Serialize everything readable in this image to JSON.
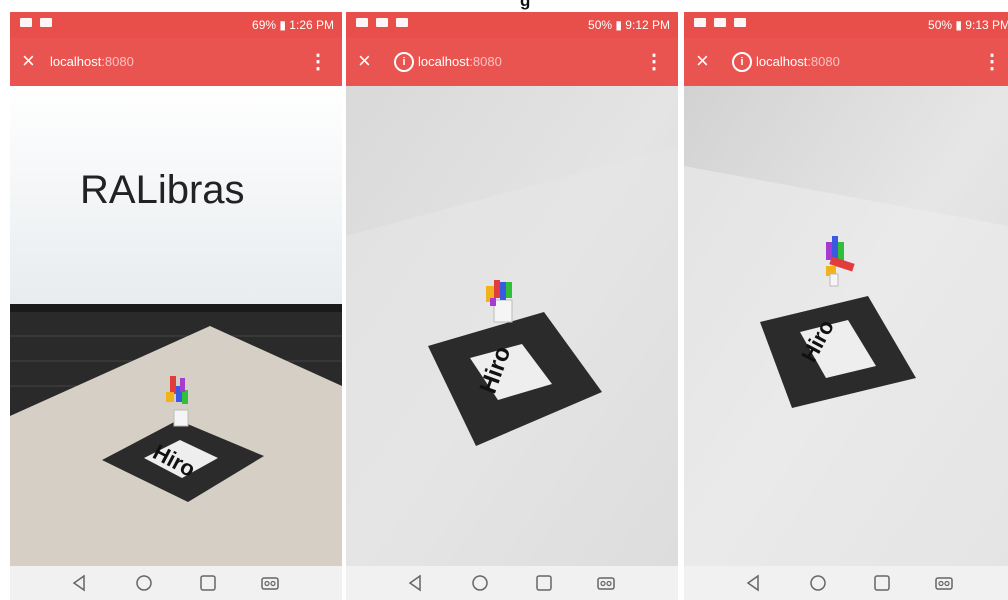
{
  "caption": {
    "visible_text": "g"
  },
  "screens": [
    {
      "status": {
        "right": "69% ▮ 1:26 PM"
      },
      "toolbar": {
        "close_glyph": "×",
        "url_host": "localhost",
        "url_port": ":8080",
        "menu_glyph": "⋮"
      },
      "laptop_text": "RALibras",
      "marker_text": "Hiro"
    },
    {
      "status": {
        "right": "50% ▮ 9:12 PM"
      },
      "toolbar": {
        "close_glyph": "×",
        "info_glyph": "i",
        "url_host": "localhost",
        "url_port": ":8080",
        "menu_glyph": "⋮"
      },
      "marker_text": "Hiro"
    },
    {
      "status": {
        "right": "50% ▮ 9:13 PM"
      },
      "toolbar": {
        "close_glyph": "×",
        "info_glyph": "i",
        "url_host": "localhost",
        "url_port": ":8080",
        "menu_glyph": "⋮"
      },
      "marker_text": "Hiro"
    }
  ],
  "colors": {
    "toolbar": "#ea5450",
    "status": "#e84f4a",
    "navbar": "#f1f1f1",
    "marker": "#2b2b2b"
  },
  "icons": [
    "close-icon",
    "info-icon",
    "overflow-menu-icon",
    "back-icon",
    "home-icon",
    "recents-icon",
    "switch-app-icon"
  ]
}
